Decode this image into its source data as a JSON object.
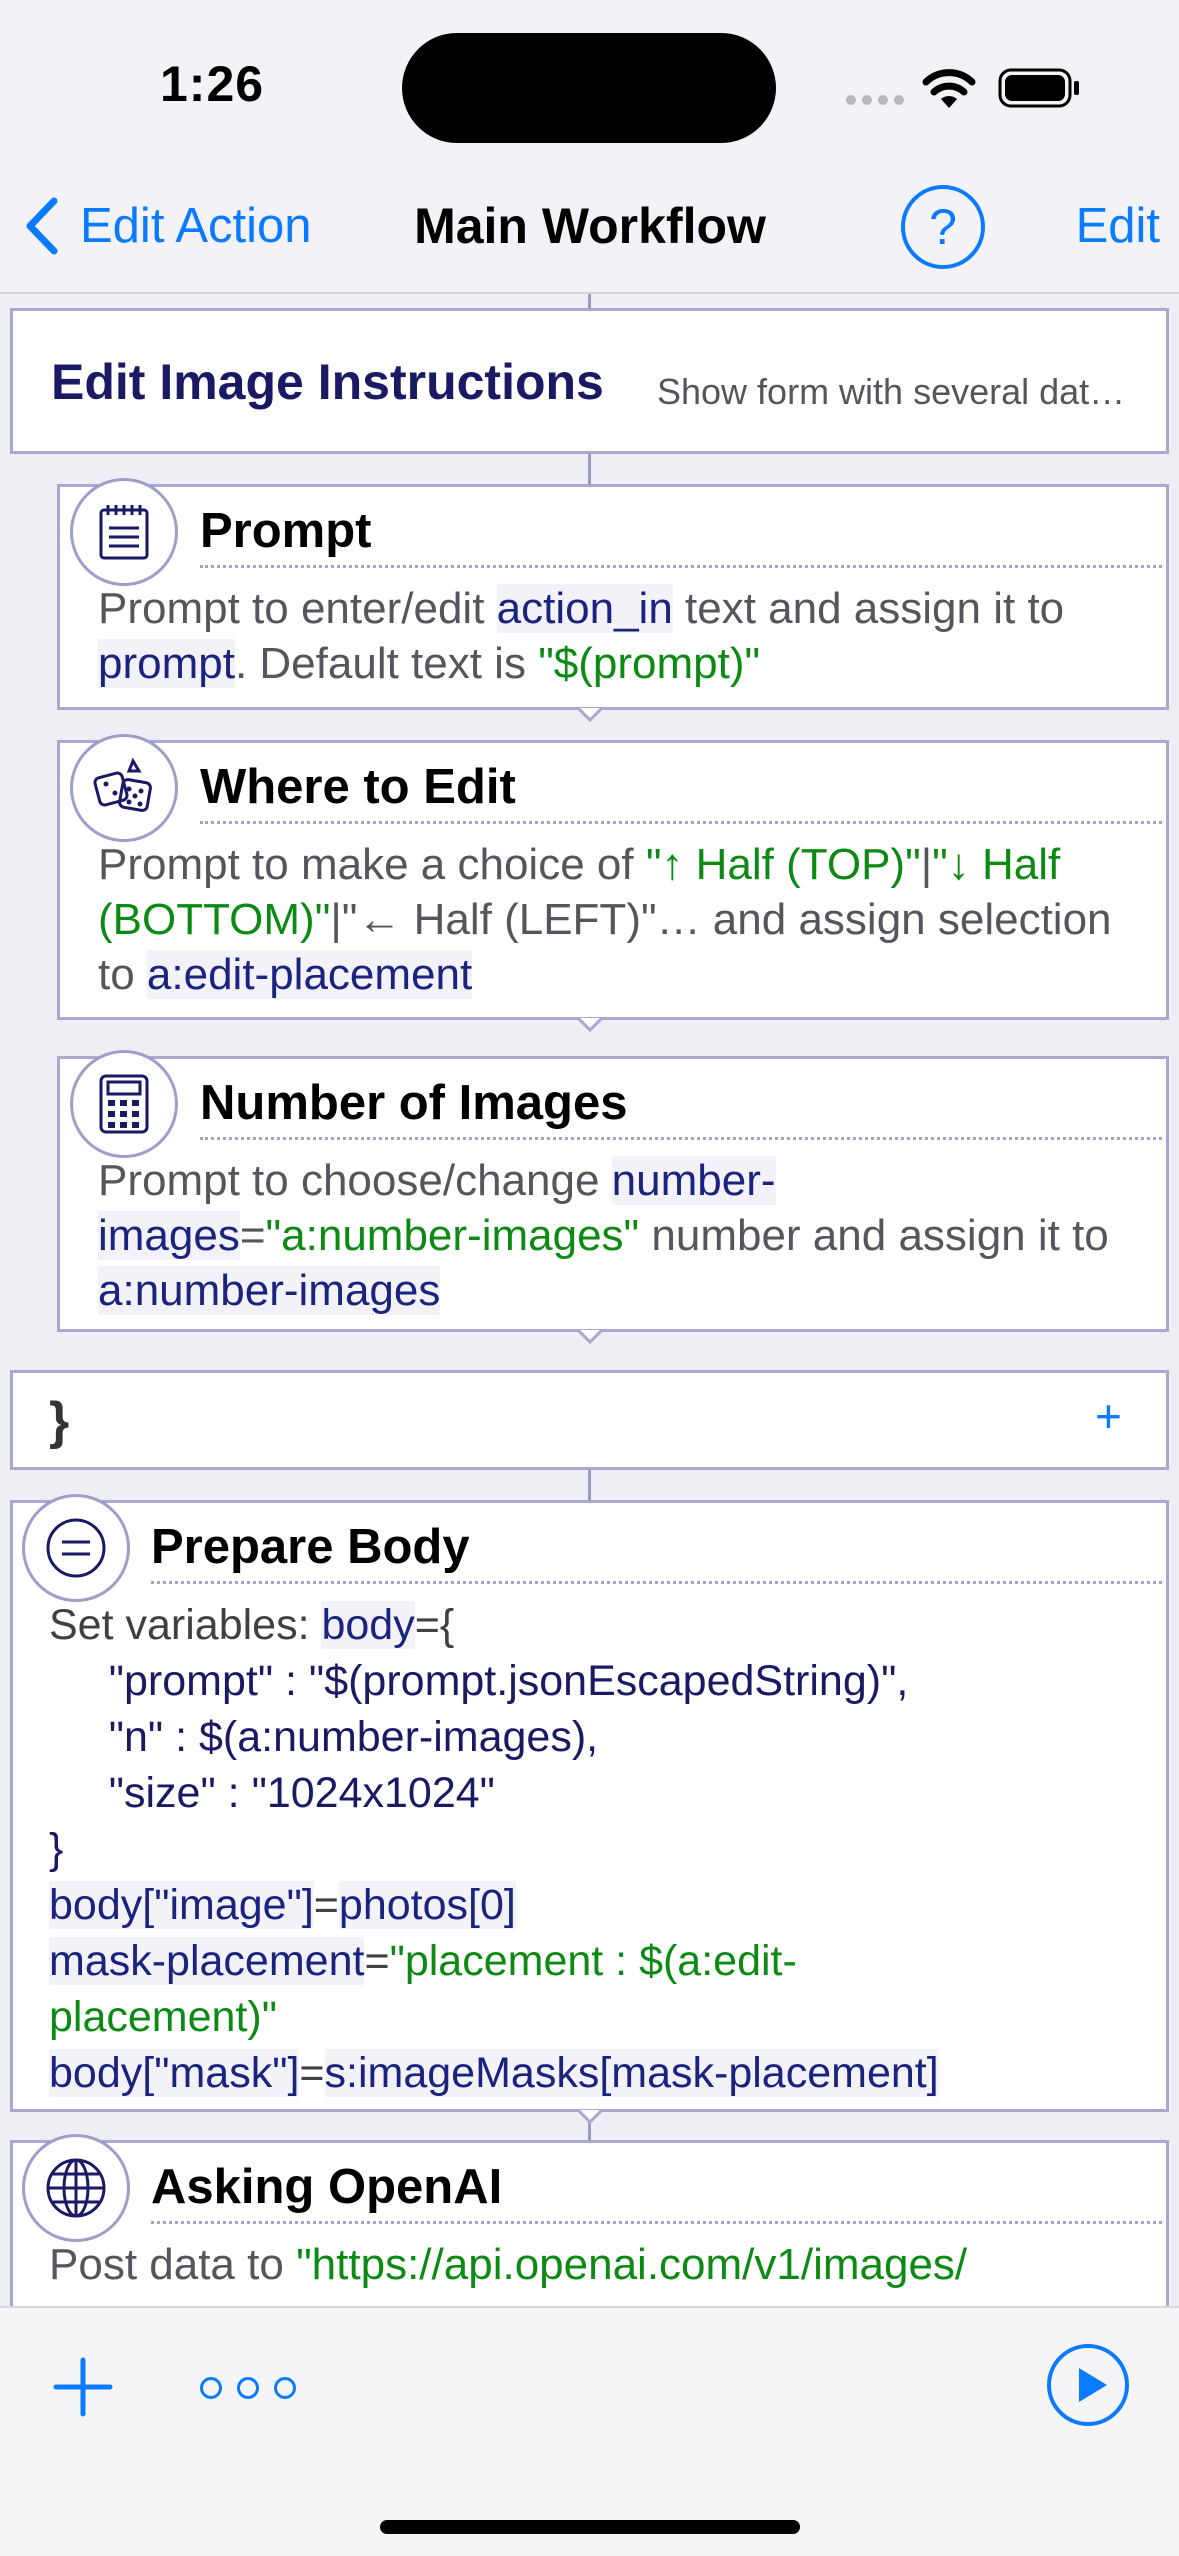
{
  "status_bar": {
    "time": "1:26"
  },
  "nav": {
    "back_label": "Edit Action",
    "title": "Main Workflow",
    "help_label": "?",
    "edit_label": "Edit"
  },
  "group": {
    "title": "Edit Image Instructions",
    "subtitle": "Show form with several dat…",
    "close_brace": "}",
    "add_label": "+"
  },
  "actions": {
    "prompt": {
      "title": "Prompt",
      "desc": {
        "t1": "Prompt to enter/edit ",
        "v1": "action_in",
        "t2": " text and assign it to ",
        "v2": "prompt",
        "t3": ". Default text is ",
        "s1": "\"$(prompt)\""
      }
    },
    "where": {
      "title": "Where to Edit",
      "desc": {
        "t1": "Prompt to make a choice of ",
        "s1": "\"↑ Half (TOP)\"",
        "t2": "|",
        "s2": "\"↓ Half (BOTTOM)\"",
        "t3": "|\"← Half (LEFT)\"… and assign selection to ",
        "v1": "a:edit-placement"
      }
    },
    "number": {
      "title": "Number of Images",
      "desc": {
        "t1": "Prompt to choose/change ",
        "v1": "number-images",
        "t2": "=",
        "s1": "\"a:number-images\"",
        "t3": " number and assign it to ",
        "v2": "a:number-images"
      }
    },
    "prepare": {
      "title": "Prepare Body",
      "lines": {
        "l1_t": "Set variables: ",
        "l1_v": "body",
        "l1_r": "={",
        "l2": "     \"prompt\" : \"$(prompt.jsonEscapedString)\",",
        "l3": "     \"n\" : $(a:number-images),",
        "l4": "     \"size\" : \"1024x1024\"",
        "l5": "}",
        "l6_v": "body[\"image\"]",
        "l6_t": "=",
        "l6_r": "photos[0]",
        "l7_v": "mask-placement",
        "l7_t": "=",
        "l7_s": "\"placement : $(a:edit-",
        "l8_s": "placement)\"",
        "l9_v": "body[\"mask\"]",
        "l9_t": "=",
        "l9_r": "s:imageMasks[mask-placement]"
      }
    },
    "openai": {
      "title": "Asking OpenAI",
      "desc": {
        "t1": "Post data to ",
        "s1": "\"https://api.openai.com/v1/images/"
      }
    }
  },
  "toolbar": {
    "add_label": "add",
    "more_label": "more",
    "run_label": "run"
  },
  "colors": {
    "accent": "#0a7aff",
    "variable": "#1a237e",
    "string": "#0c8a14",
    "card_border": "#a8a8d0"
  }
}
